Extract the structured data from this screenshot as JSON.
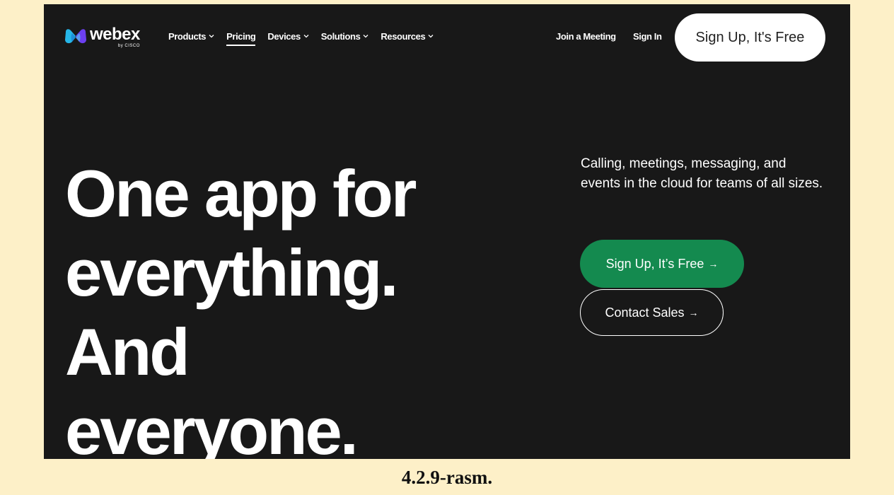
{
  "brand": {
    "name": "webex",
    "sub": "by CISCO",
    "icon": "webex-logo-icon",
    "colors": {
      "logo_left": "#26b6e8",
      "logo_right": "#6c3ff0"
    }
  },
  "nav": {
    "items": [
      {
        "label": "Products",
        "has_dropdown": true
      },
      {
        "label": "Pricing",
        "has_dropdown": false,
        "active": true
      },
      {
        "label": "Devices",
        "has_dropdown": true
      },
      {
        "label": "Solutions",
        "has_dropdown": true
      },
      {
        "label": "Resources",
        "has_dropdown": true
      }
    ],
    "join_label": "Join a Meeting",
    "signin_label": "Sign In",
    "signup_label": "Sign Up, It's Free"
  },
  "hero": {
    "lines": [
      "One app for",
      "everything.",
      "And",
      "everyone."
    ]
  },
  "tagline": "Calling, meetings, messaging, and events in the cloud for teams of all sizes.",
  "cta": {
    "primary": "Sign Up, It’s Free",
    "primary_color": "#148a4f",
    "secondary": "Contact Sales",
    "arrow": "→"
  },
  "caption": "4.2.9-rasm."
}
